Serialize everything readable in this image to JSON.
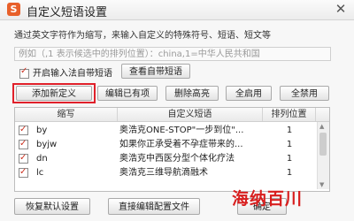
{
  "window": {
    "title": "自定义短语设置",
    "close_glyph": "✕",
    "logo_letter": "S"
  },
  "description": "通过英文字符作为缩写，来输入自定义的特殊符号、短语、短文等",
  "example": "例如（,1 表示候选中的排列位置）：china,1=中华人民共和国",
  "autoload": {
    "label": "开启输入法自带短语",
    "checked": true,
    "view_button": "查看自带短语"
  },
  "toolbar": {
    "add": "添加新定义",
    "edit": "编辑已有项",
    "delete": "删除高亮",
    "enable_all": "全启用",
    "disable_all": "全禁用"
  },
  "table": {
    "headers": [
      "缩写",
      "自定义短语",
      "排列位置"
    ],
    "rows": [
      {
        "checked": true,
        "abbr": "by",
        "phrase": "奥浩克ONE-STOP\"一步到位\"...",
        "pos": "1"
      },
      {
        "checked": true,
        "abbr": "byjw",
        "phrase": "如果你正承受着不孕症带来的...",
        "pos": "1"
      },
      {
        "checked": true,
        "abbr": "dn",
        "phrase": "奥浩克中西医分型个体化疗法",
        "pos": "1"
      },
      {
        "checked": true,
        "abbr": "lc",
        "phrase": "奥浩克三维导航滴融术",
        "pos": "1"
      }
    ]
  },
  "footer": {
    "restore": "恢复默认设置",
    "edit_file": "直接编辑配置文件",
    "ok": "确定"
  },
  "watermark": "海纳百川",
  "colors": {
    "highlight": "#e0202a",
    "watermark": "#d81e1e",
    "logo": "#e8602a"
  }
}
